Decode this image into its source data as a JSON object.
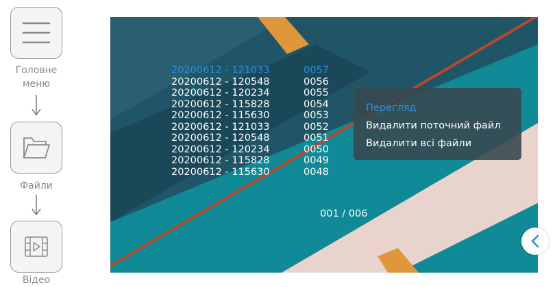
{
  "sidebar": {
    "items": [
      {
        "label_line1": "Головне",
        "label_line2": "меню",
        "icon": "hamburger-menu-icon"
      },
      {
        "label": "Файли",
        "icon": "folder-icon"
      },
      {
        "label": "Відео",
        "icon": "video-film-icon"
      }
    ]
  },
  "file_list": [
    {
      "name": "20200612 - 121033",
      "index": "0057",
      "selected": true
    },
    {
      "name": "20200612 - 120548",
      "index": "0056"
    },
    {
      "name": "20200612 - 120234",
      "index": "0055"
    },
    {
      "name": "20200612 - 115828",
      "index": "0054"
    },
    {
      "name": "20200612 - 115630",
      "index": "0053"
    },
    {
      "name": "20200612 - 121033",
      "index": "0052"
    },
    {
      "name": "20200612 - 120548",
      "index": "0051"
    },
    {
      "name": "20200612 - 120234",
      "index": "0050"
    },
    {
      "name": "20200612 - 115828",
      "index": "0049"
    },
    {
      "name": "20200612 - 115630",
      "index": "0048"
    }
  ],
  "pager": {
    "text": "001 / 006"
  },
  "context_menu": {
    "items": [
      {
        "label": "Перегляд",
        "active": true
      },
      {
        "label": "Видалити поточний файл"
      },
      {
        "label": "Видалити всі файли"
      }
    ]
  },
  "back_button": {
    "icon": "chevron-left-icon"
  },
  "colors": {
    "accent": "#2a8ee0",
    "background_teal": "#0f8a96",
    "background_dark": "#234a5a"
  }
}
